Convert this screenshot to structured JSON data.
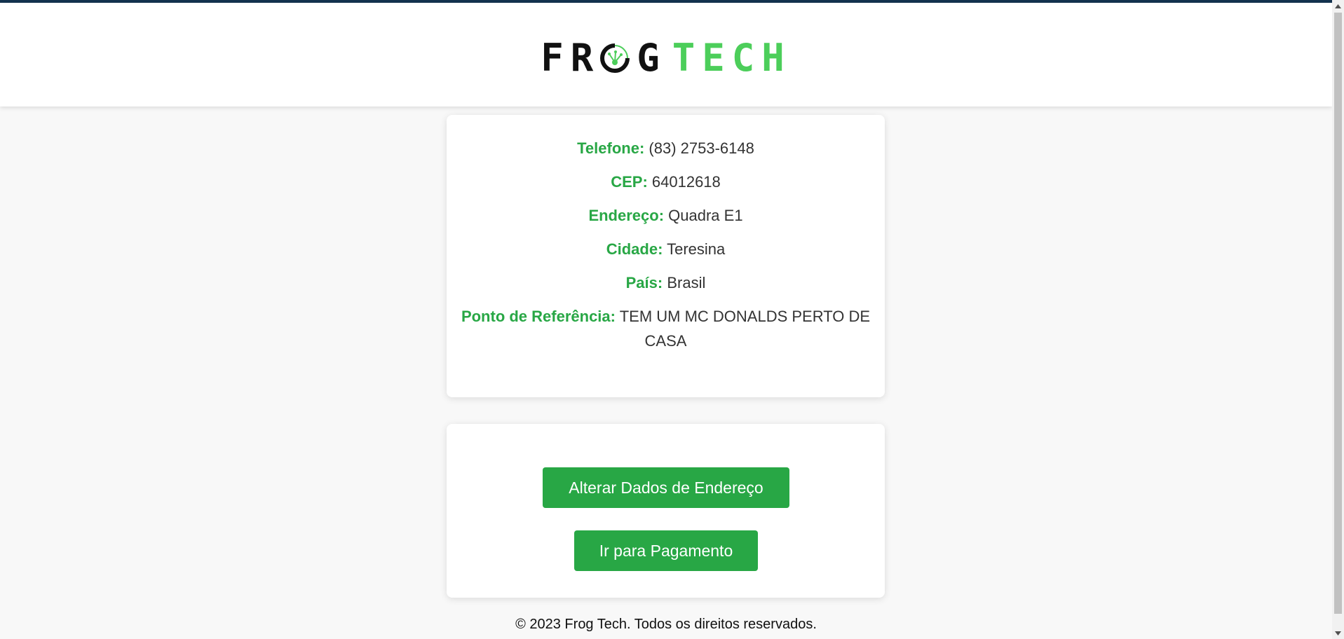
{
  "header": {
    "logo_part1": "FR",
    "logo_part2": "G",
    "logo_part3": "TECH"
  },
  "info": {
    "telefone_label": "Telefone:",
    "telefone_value": "(83) 2753-6148",
    "cep_label": "CEP:",
    "cep_value": "64012618",
    "endereco_label": "Endereço:",
    "endereco_value": "Quadra E1",
    "cidade_label": "Cidade:",
    "cidade_value": "Teresina",
    "pais_label": "País:",
    "pais_value": "Brasil",
    "referencia_label": "Ponto de Referência:",
    "referencia_value": "TEM UM MC DONALDS PERTO DE CASA"
  },
  "actions": {
    "change_address_label": "Alterar Dados de Endereço",
    "payment_label": "Ir para Pagamento"
  },
  "footer": {
    "copyright": "© 2023 Frog Tech. Todos os direitos reservados."
  },
  "colors": {
    "accent": "#28a745",
    "logo_green": "#4cce5a",
    "top_bar": "#14334f"
  }
}
